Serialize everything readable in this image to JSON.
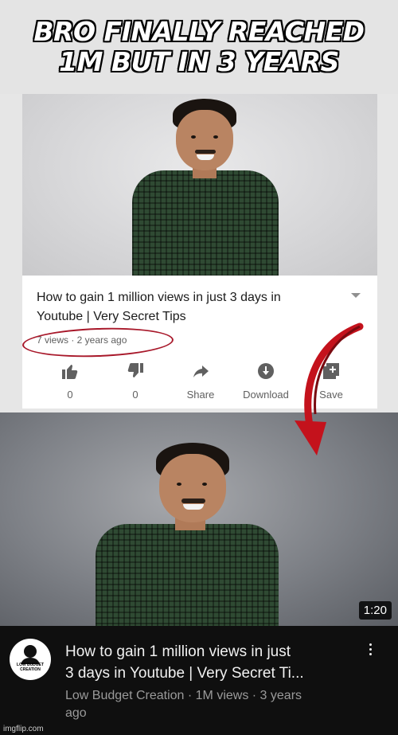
{
  "meme": {
    "caption_line1": "BRO FINALLY REACHED",
    "caption_line2": "1M BUT IN 3 YEARS"
  },
  "top_video": {
    "title_line1": "How to gain 1 million views in just 3 days in",
    "title_line2": "Youtube | Very Secret Tips",
    "meta": "7 views · 2 years ago",
    "actions": {
      "like_count": "0",
      "dislike_count": "0",
      "share_label": "Share",
      "download_label": "Download",
      "save_label": "Save"
    }
  },
  "bottom_video": {
    "duration": "1:20",
    "title_line1": "How to gain 1 million views in just",
    "title_line2": "3 days in Youtube | Very Secret Ti...",
    "meta_line1": "Low Budget Creation · 1M views · 3 years",
    "meta_line2": "ago",
    "avatar_text": "LOW BUDGET CREATION"
  },
  "watermark": "imgflip.com",
  "colors": {
    "circle_annotation": "#a8182a",
    "arrow": "#c4121c",
    "dark_bg": "#0f0f0f"
  }
}
